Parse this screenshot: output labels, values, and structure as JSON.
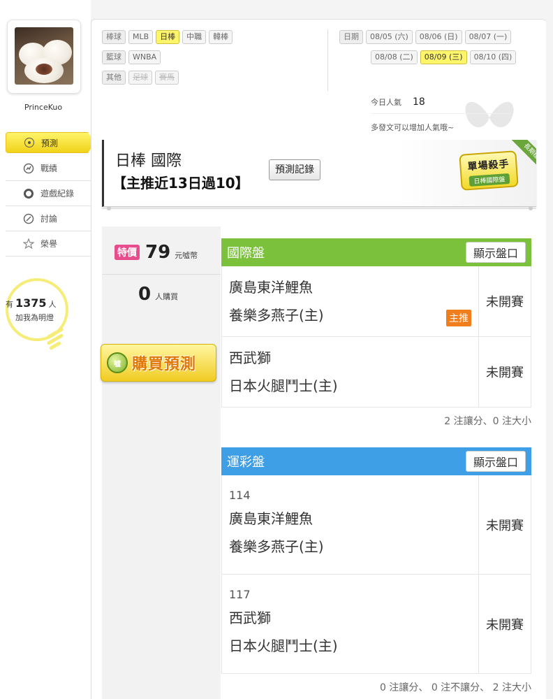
{
  "sidebar": {
    "username": "PrinceKuo",
    "nav": [
      {
        "label": "預測",
        "icon": "target-icon",
        "active": true
      },
      {
        "label": "戰績",
        "icon": "chart-icon"
      },
      {
        "label": "遊戲紀錄",
        "icon": "record-icon"
      },
      {
        "label": "討論",
        "icon": "discussion-icon"
      },
      {
        "label": "榮譽",
        "icon": "medal-icon"
      }
    ],
    "lamp": {
      "prefix": "有",
      "count": "1375",
      "suffix": "人",
      "cta": "加我為明燈"
    }
  },
  "categories": {
    "baseball": {
      "label": "棒球",
      "items": [
        "MLB",
        "日棒",
        "中職",
        "韓棒"
      ],
      "selected": "日棒"
    },
    "basketball": {
      "label": "籃球",
      "items": [
        "WNBA"
      ]
    },
    "other": {
      "label": "其他",
      "items": [
        "足球",
        "賽馬"
      ]
    }
  },
  "dates": {
    "label": "日期",
    "items": [
      "08/05 (六)",
      "08/06 (日)",
      "08/07 (一)",
      "08/08 (二)",
      "08/09 (三)",
      "08/10 (四)"
    ],
    "selected": "08/09 (三)"
  },
  "popularity": {
    "label": "今日人氣",
    "value": "18",
    "hint": "多發文可以增加人氣哦~"
  },
  "header": {
    "title": "日棒 國際",
    "claim": "【主推近13日過10】",
    "record_button": "預測記錄",
    "badge_main": "單場殺手",
    "badge_sub": "日棒國際盤",
    "ribbon": "長期穩定"
  },
  "purchase": {
    "sale_label": "特價",
    "price": "79",
    "price_unit": "元噓幣",
    "buyers": "0",
    "buyers_unit": "人購買",
    "coin_text": "噓",
    "button": "購買預測"
  },
  "intl_table": {
    "title": "國際盤",
    "show_button": "顯示盤口",
    "games": [
      {
        "away": "廣島東洋鯉魚",
        "home": "養樂多燕子(主)",
        "status": "未開賽",
        "tag": "主推"
      },
      {
        "away": "西武獅",
        "home": "日本火腿鬥士(主)",
        "status": "未開賽"
      }
    ],
    "summary": "2 注讓分、0 注大小"
  },
  "lottery_table": {
    "title": "運彩盤",
    "show_button": "顯示盤口",
    "games": [
      {
        "no": "114",
        "away": "廣島東洋鯉魚",
        "home": "養樂多燕子(主)",
        "status": "未開賽"
      },
      {
        "no": "117",
        "away": "西武獅",
        "home": "日本火腿鬥士(主)",
        "status": "未開賽"
      }
    ],
    "summary": "0 注讓分、 0 注不讓分、 2 注大小"
  },
  "colors": {
    "accent_yellow": "#fff56b",
    "green_header": "#7cc13c",
    "blue_header": "#3f9fe6",
    "sale_pink": "#e74c8c",
    "main_tag_orange": "#f07e1d"
  }
}
